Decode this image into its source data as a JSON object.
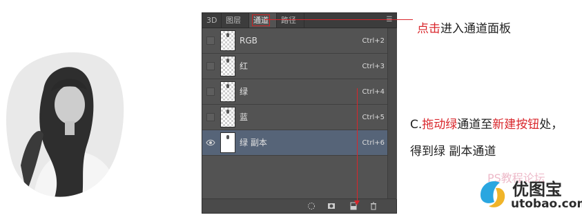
{
  "panel": {
    "tabs": [
      {
        "label": "3D"
      },
      {
        "label": "图层"
      },
      {
        "label": "通道"
      },
      {
        "label": "路径"
      }
    ],
    "channels": [
      {
        "name": "RGB",
        "shortcut": "Ctrl+2"
      },
      {
        "name": "红",
        "shortcut": "Ctrl+3"
      },
      {
        "name": "绿",
        "shortcut": "Ctrl+4"
      },
      {
        "name": "蓝",
        "shortcut": "Ctrl+5"
      },
      {
        "name": "绿 副本",
        "shortcut": "Ctrl+6"
      }
    ]
  },
  "annotations": {
    "note1_red": "点击",
    "note1_rest": "进入通道面板",
    "note2_prefix": "C.",
    "note2_red1": "拖动绿",
    "note2_mid": "通道至",
    "note2_red2": "新建按钮",
    "note2_end": "处，",
    "note3": "得到绿 副本通道"
  },
  "watermark": {
    "forum": "PS教程论坛",
    "brand": "优图宝",
    "domain": "utobao.com"
  },
  "colors": {
    "annotation_red": "#d9262b",
    "panel_bg": "#535353",
    "selected_row": "#566478"
  }
}
